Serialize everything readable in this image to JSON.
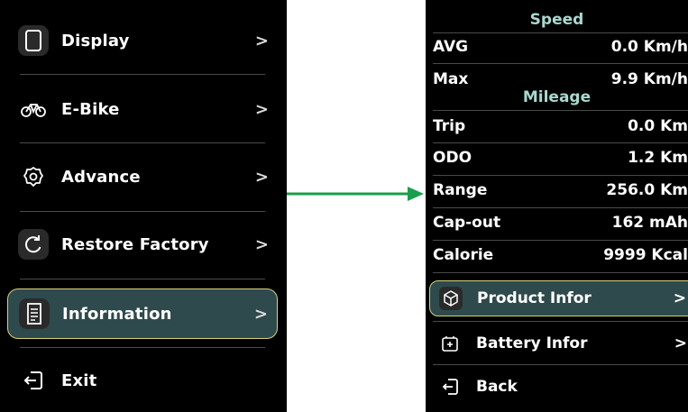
{
  "left_menu": {
    "items": [
      {
        "label": "Display",
        "icon": "display-icon",
        "chevron": ">"
      },
      {
        "label": "E-Bike",
        "icon": "bicycle-icon",
        "chevron": ">"
      },
      {
        "label": "Advance",
        "icon": "gear-icon",
        "chevron": ">"
      },
      {
        "label": "Restore Factory",
        "icon": "restore-icon",
        "chevron": ">"
      },
      {
        "label": "Information",
        "icon": "document-icon",
        "chevron": ">",
        "selected": true
      },
      {
        "label": "Exit",
        "icon": "exit-icon"
      }
    ]
  },
  "right_panel": {
    "speed_title": "Speed",
    "speed_rows": [
      {
        "key": "AVG",
        "value": "0.0  Km/h"
      },
      {
        "key": "Max",
        "value": "9.9  Km/h"
      }
    ],
    "mileage_title": "Mileage",
    "mileage_rows": [
      {
        "key": "Trip",
        "value": "0.0  Km"
      },
      {
        "key": "ODO",
        "value": "1.2  Km"
      },
      {
        "key": "Range",
        "value": "256.0  Km"
      },
      {
        "key": "Cap-out",
        "value": "162  mAh"
      },
      {
        "key": "Calorie",
        "value": "9999  Kcal"
      }
    ],
    "items": [
      {
        "label": "Product Infor",
        "icon": "box-icon",
        "chevron": ">",
        "selected": true
      },
      {
        "label": "Battery Infor",
        "icon": "battery-icon",
        "chevron": ">"
      },
      {
        "label": "Back",
        "icon": "back-icon"
      }
    ]
  },
  "colors": {
    "background": "#000000",
    "selected_fill": "#2f4a4c",
    "selected_border": "#d6d27a",
    "section_title": "#a9d8cf",
    "arrow": "#1a9e4b"
  }
}
